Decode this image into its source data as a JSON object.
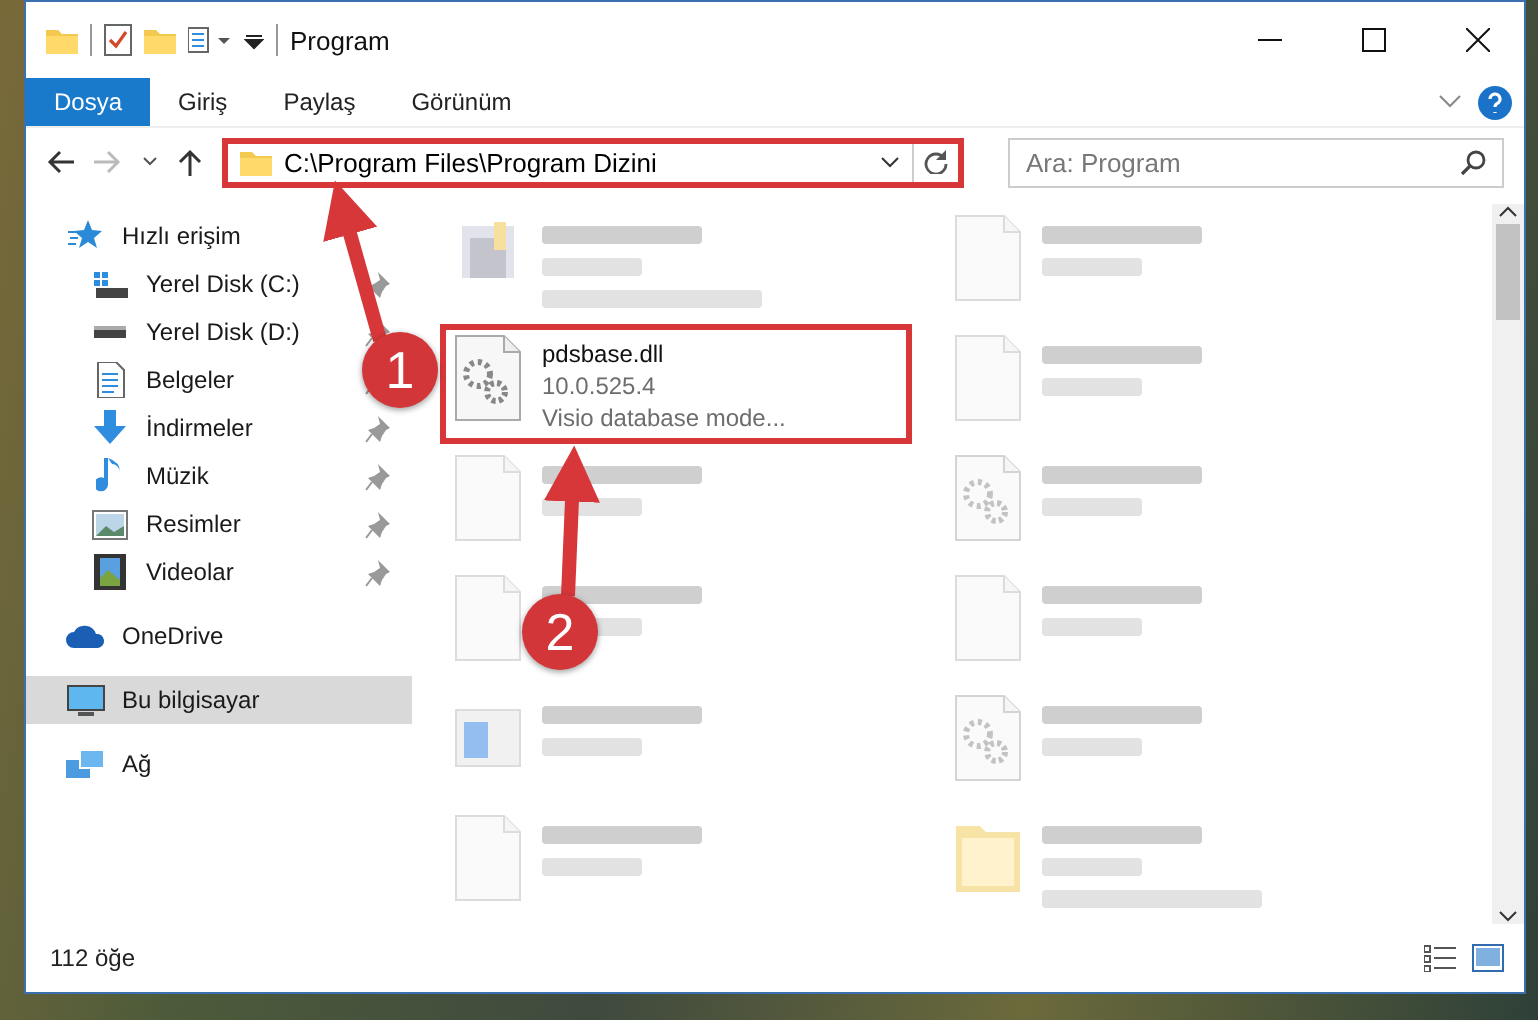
{
  "window": {
    "title": "Program"
  },
  "ribbon_tabs": [
    {
      "label": "Dosya",
      "selected": true
    },
    {
      "label": "Giriş",
      "selected": false
    },
    {
      "label": "Paylaş",
      "selected": false
    },
    {
      "label": "Görünüm",
      "selected": false
    }
  ],
  "address": {
    "path": "C:\\Program Files\\Program Dizini",
    "highlighted": true
  },
  "search": {
    "placeholder": "Ara: Program"
  },
  "sidebar": {
    "items": [
      {
        "label": "Hızlı erişim",
        "kind": "star",
        "selected": false,
        "children": [
          {
            "label": "Yerel Disk (C:)",
            "kind": "drive-c",
            "pinned": true,
            "selected": false
          },
          {
            "label": "Yerel Disk (D:)",
            "kind": "drive",
            "pinned": true,
            "selected": false
          },
          {
            "label": "Belgeler",
            "kind": "docs",
            "pinned": true,
            "selected": false
          },
          {
            "label": "İndirmeler",
            "kind": "download",
            "pinned": true,
            "selected": false
          },
          {
            "label": "Müzik",
            "kind": "music",
            "pinned": true,
            "selected": false
          },
          {
            "label": "Resimler",
            "kind": "pictures",
            "pinned": true,
            "selected": false
          },
          {
            "label": "Videolar",
            "kind": "video",
            "pinned": true,
            "selected": false
          }
        ]
      },
      {
        "label": "OneDrive",
        "kind": "cloud",
        "selected": false
      },
      {
        "label": "Bu bilgisayar",
        "kind": "computer",
        "selected": true
      },
      {
        "label": "Ağ",
        "kind": "network",
        "selected": false
      }
    ]
  },
  "files": [
    {
      "kind": "exe",
      "blurred": true
    },
    {
      "kind": "doc",
      "blurred": true
    },
    {
      "name": "pdsbase.dll",
      "lines": [
        "10.0.525.4",
        "Visio database mode..."
      ],
      "kind": "gear",
      "blurred": false,
      "highlighted": true
    },
    {
      "kind": "doc",
      "blurred": true
    },
    {
      "kind": "doc",
      "blurred": true
    },
    {
      "kind": "gear",
      "blurred": true
    },
    {
      "kind": "doc",
      "blurred": true
    },
    {
      "kind": "doc",
      "blurred": true
    },
    {
      "kind": "installer",
      "blurred": true
    },
    {
      "kind": "gear",
      "blurred": true
    },
    {
      "kind": "doc",
      "blurred": true
    },
    {
      "kind": "folder",
      "blurred": true
    }
  ],
  "annotations": [
    {
      "number": "1"
    },
    {
      "number": "2"
    }
  ],
  "status_bar": {
    "count": "112 öğe"
  }
}
